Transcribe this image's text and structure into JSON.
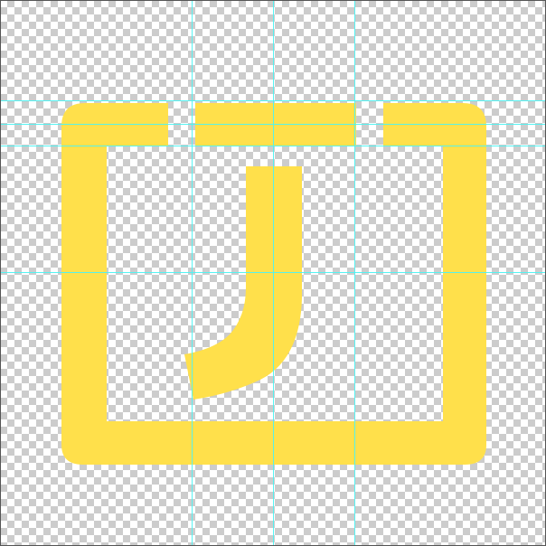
{
  "canvas": {
    "transparency_pattern": "checkerboard",
    "checker_light": "#ffffff",
    "checker_dark": "#cccccc"
  },
  "artwork": {
    "shape_color": "#ffe04b",
    "description_icon": "bracketed-j-icon"
  },
  "guides": {
    "color": "#4ef2f2",
    "horizontal_count": 4,
    "vertical_count": 3
  }
}
